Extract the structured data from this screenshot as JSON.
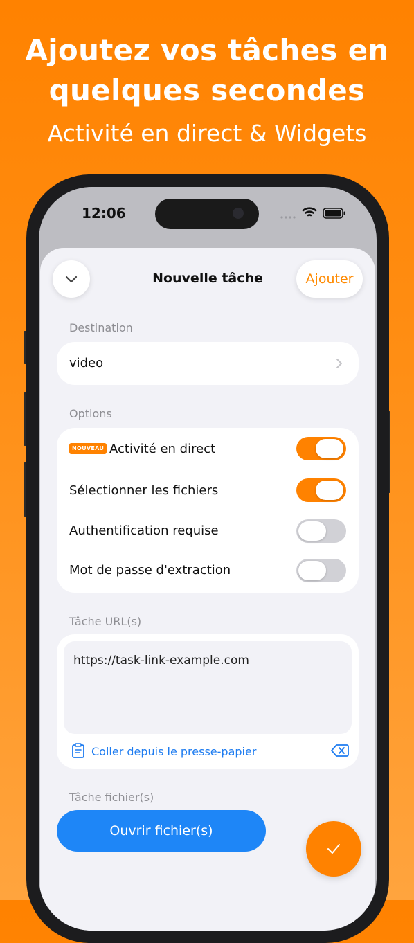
{
  "promo": {
    "headline_line1": "Ajoutez vos tâches en",
    "headline_line2": "quelques secondes",
    "subtitle": "Activité en direct & Widgets"
  },
  "status_bar": {
    "time": "12:06"
  },
  "sheet": {
    "title": "Nouvelle tâche",
    "add_label": "Ajouter"
  },
  "destination": {
    "section_label": "Destination",
    "value": "video"
  },
  "options": {
    "section_label": "Options",
    "items": [
      {
        "label": "Activité en direct",
        "badge": "NOUVEAU",
        "on": true
      },
      {
        "label": "Sélectionner les fichiers",
        "on": true
      },
      {
        "label": "Authentification requise",
        "on": false
      },
      {
        "label": "Mot de passe d'extraction",
        "on": false
      }
    ]
  },
  "urls": {
    "section_label": "Tâche URL(s)",
    "value": "https://task-link-example.com",
    "paste_label": "Coller depuis le presse-papier"
  },
  "files": {
    "section_label": "Tâche fichier(s)",
    "open_label": "Ouvrir fichier(s)"
  },
  "colors": {
    "accent": "#FF8200",
    "link": "#1E7CF0",
    "primary_button": "#1E86F7"
  },
  "icons": [
    "chevron-down-icon",
    "chevron-right-icon",
    "clipboard-icon",
    "clear-icon",
    "checkmark-icon",
    "wifi-icon",
    "battery-icon",
    "signal-icon"
  ]
}
